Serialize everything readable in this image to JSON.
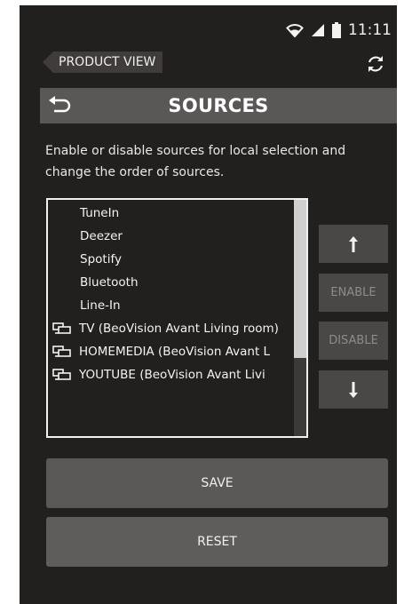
{
  "status_bar": {
    "time": "11:11",
    "icons": [
      "wifi-icon",
      "signal-icon",
      "battery-icon"
    ]
  },
  "top": {
    "product_view_label": "PRODUCT VIEW",
    "refresh_icon": "refresh-icon"
  },
  "header": {
    "title": "SOURCES",
    "back_icon": "back-icon"
  },
  "description": "Enable or disable sources for local selection and change the order of sources.",
  "sources": [
    {
      "label": "TuneIn",
      "device_icon": false
    },
    {
      "label": "Deezer",
      "device_icon": false
    },
    {
      "label": "Spotify",
      "device_icon": false
    },
    {
      "label": "Bluetooth",
      "device_icon": false
    },
    {
      "label": "Line-In",
      "device_icon": false
    },
    {
      "label": "TV (BeoVision Avant Living room)",
      "device_icon": true
    },
    {
      "label": "HOMEMEDIA  (BeoVision Avant L",
      "device_icon": true
    },
    {
      "label": "YOUTUBE  (BeoVision Avant Livi",
      "device_icon": true
    }
  ],
  "side_buttons": {
    "up_icon": "arrow-up-icon",
    "enable": "ENABLE",
    "disable": "DISABLE",
    "down_icon": "arrow-down-icon"
  },
  "actions": {
    "save": "SAVE",
    "reset": "RESET"
  },
  "colors": {
    "background": "#221f1f",
    "header": "#5a5757",
    "button": "#5b5858"
  }
}
